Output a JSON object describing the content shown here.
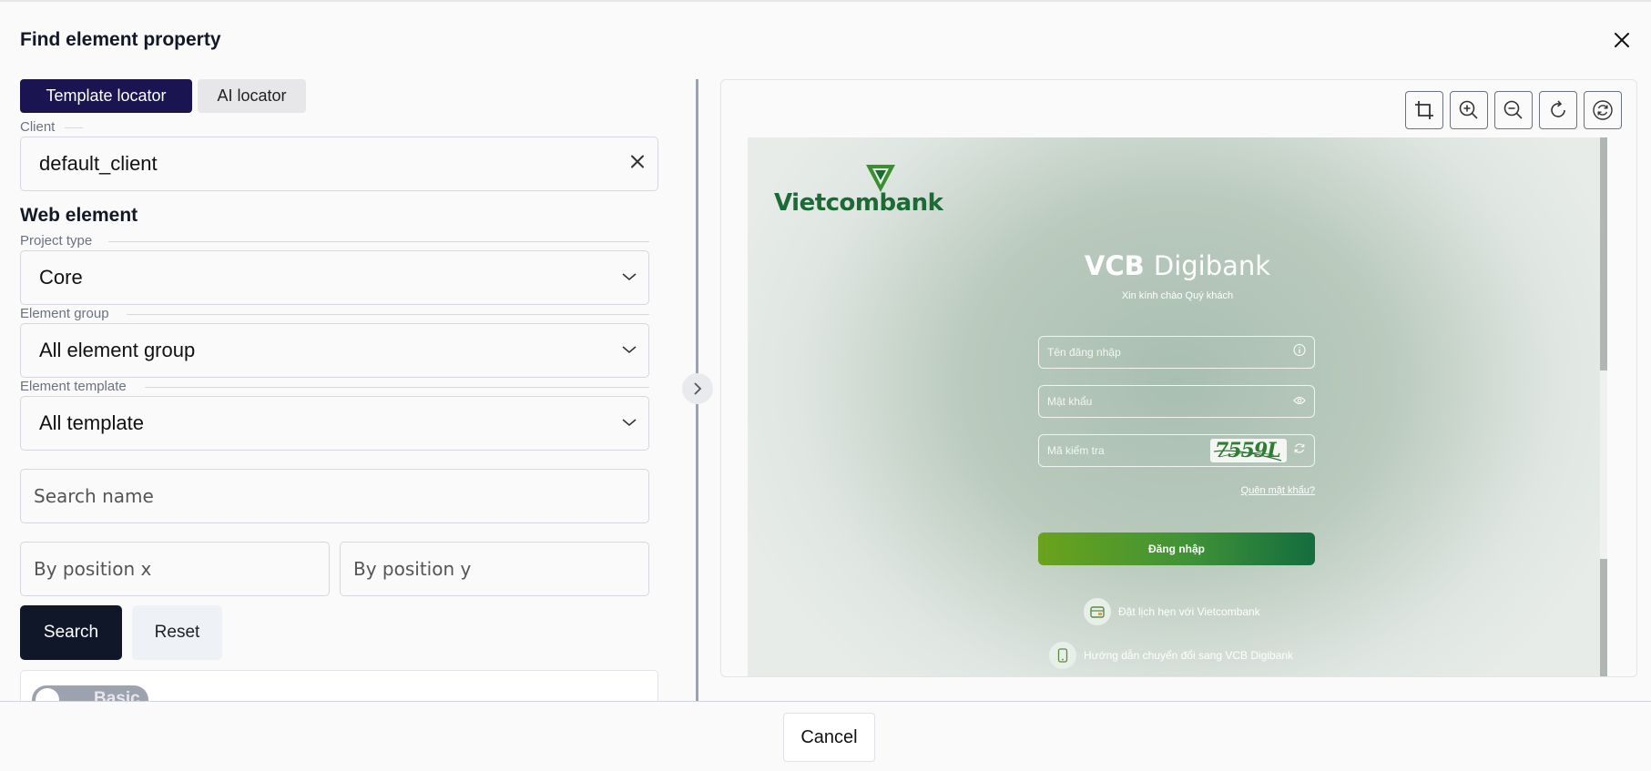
{
  "dialog": {
    "title": "Find element property"
  },
  "tabs": [
    {
      "label": "Template locator",
      "active": true
    },
    {
      "label": "AI locator",
      "active": false
    }
  ],
  "client": {
    "label": "Client",
    "value": "default_client"
  },
  "web_element": {
    "title": "Web element",
    "project_type": {
      "label": "Project type",
      "value": "Core"
    },
    "element_group": {
      "label": "Element group",
      "value": "All element group"
    },
    "element_template": {
      "label": "Element template",
      "value": "All template"
    },
    "search_name": {
      "placeholder": "Search name"
    },
    "position_x": {
      "placeholder": "By position x"
    },
    "position_y": {
      "placeholder": "By position y"
    },
    "search_label": "Search",
    "reset_label": "Reset",
    "toggle_label": "Basic"
  },
  "preview": {
    "logo_text": "Vietcombank",
    "title_bold": "VCB",
    "title_light": "Digibank",
    "subtitle": "Xin kính chào Quý khách",
    "username_placeholder": "Tên đăng nhập",
    "password_placeholder": "Mật khẩu",
    "captcha_placeholder": "Mã kiểm tra",
    "captcha_text": "7559L",
    "forgot_label": "Quên mật khẩu?",
    "login_label": "Đăng nhập",
    "link_appointment": "Đặt lịch hẹn với Vietcombank",
    "link_guide": "Hướng dẫn chuyển đổi sang VCB Digibank"
  },
  "footer": {
    "cancel_label": "Cancel"
  },
  "colors": {
    "primary": "#1a1450",
    "search_button": "#0f1729",
    "vcb_green": "#1c6b34"
  }
}
